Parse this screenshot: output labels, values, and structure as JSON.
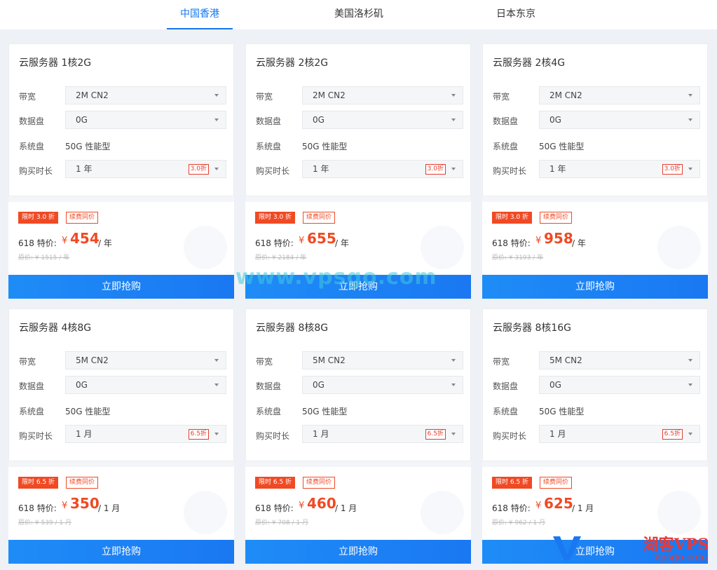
{
  "tabs": [
    {
      "label": "中国香港",
      "active": true
    },
    {
      "label": "美国洛杉矶",
      "active": false
    },
    {
      "label": "日本东京",
      "active": false
    }
  ],
  "labels": {
    "bandwidth": "带宽",
    "data_disk": "数据盘",
    "system_disk": "系统盘",
    "duration": "购买时长",
    "special_price": "618 特价:",
    "currency": "¥",
    "buy": "立即抢购"
  },
  "cards": [
    {
      "title": "云服务器 1核2G",
      "bandwidth": "2M CN2",
      "data_disk": "0G",
      "system_disk": "50G 性能型",
      "duration": "1 年",
      "discount_tag": "3.0折",
      "badge": "限时 3.0 折",
      "badge2": "续费同价",
      "price": "454",
      "unit": "/ 年",
      "orig": "原价: ¥ 1515 / 年"
    },
    {
      "title": "云服务器 2核2G",
      "bandwidth": "2M CN2",
      "data_disk": "0G",
      "system_disk": "50G 性能型",
      "duration": "1 年",
      "discount_tag": "3.0折",
      "badge": "限时 3.0 折",
      "badge2": "续费同价",
      "price": "655",
      "unit": "/ 年",
      "orig": "原价: ¥ 2184 / 年"
    },
    {
      "title": "云服务器 2核4G",
      "bandwidth": "2M CN2",
      "data_disk": "0G",
      "system_disk": "50G 性能型",
      "duration": "1 年",
      "discount_tag": "3.0折",
      "badge": "限时 3.0 折",
      "badge2": "续费同价",
      "price": "958",
      "unit": "/ 年",
      "orig": "原价: ¥ 3193 / 年"
    },
    {
      "title": "云服务器 4核8G",
      "bandwidth": "5M CN2",
      "data_disk": "0G",
      "system_disk": "50G 性能型",
      "duration": "1 月",
      "discount_tag": "6.5折",
      "badge": "限时 6.5 折",
      "badge2": "续费同价",
      "price": "350",
      "unit": "/ 1 月",
      "orig": "原价: ¥ 539 / 1 月"
    },
    {
      "title": "云服务器 8核8G",
      "bandwidth": "5M CN2",
      "data_disk": "0G",
      "system_disk": "50G 性能型",
      "duration": "1 月",
      "discount_tag": "6.5折",
      "badge": "限时 6.5 折",
      "badge2": "续费同价",
      "price": "460",
      "unit": "/ 1 月",
      "orig": "原价: ¥ 708 / 1 月"
    },
    {
      "title": "云服务器 8核16G",
      "bandwidth": "5M CN2",
      "data_disk": "0G",
      "system_disk": "50G 性能型",
      "duration": "1 月",
      "discount_tag": "6.5折",
      "badge": "限时 6.5 折",
      "badge2": "续费同价",
      "price": "625",
      "unit": "/ 1 月",
      "orig": "原价: ¥ 962 / 1 月"
    }
  ],
  "watermark": {
    "text": "www.vpsgo.com",
    "logo_cn": "湖客VPS",
    "logo_en": "vpsgo.com"
  },
  "colors": {
    "accent": "#1677f0",
    "price": "#f04a24",
    "button": "#1a78f2"
  }
}
